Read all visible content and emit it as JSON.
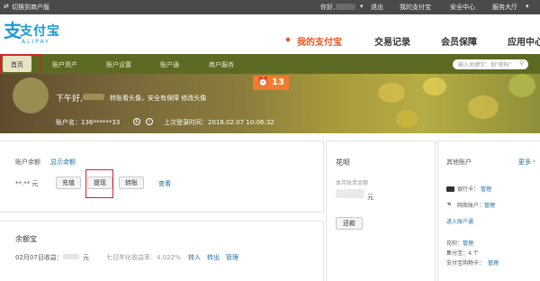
{
  "topbar": {
    "switch_label": "切换到商户版",
    "greeting": "你好,",
    "logout": "退出",
    "my_alipay": "我的支付宝",
    "security_center": "安全中心",
    "service_hall": "服务大厅"
  },
  "header": {
    "logo_cn": "支付宝",
    "logo_en": "ALIPAY",
    "nav": [
      "我的支付宝",
      "交易记录",
      "会员保障",
      "应用中心"
    ]
  },
  "subnav": {
    "items": [
      "首页",
      "账户资产",
      "账户设置",
      "账户通",
      "商户服务"
    ],
    "search_placeholder": "输入关键字：如\"密码\""
  },
  "banner": {
    "greeting": "下午好,",
    "tip": "转账看头像，安全有保障 修改头像",
    "badge_count": "13",
    "account_label": "账户名：136******33",
    "last_login": "上次登录时间：2018.02.07 10:06:32"
  },
  "balance": {
    "title": "账户余额",
    "show_link": "显示余额",
    "amount": "**.** 元",
    "recharge": "充值",
    "withdraw": "提现",
    "transfer": "转账",
    "view": "查看"
  },
  "yuebao": {
    "title": "余额宝",
    "income_label": "02月07日收益：",
    "income_unit": "元",
    "rate": "七日年化收益率：4.022%",
    "transfer_in": "转入",
    "transfer_out": "转出",
    "manage": "管理"
  },
  "huabei": {
    "title": "花呗",
    "bill_label": "本月账单金额",
    "unit": "元",
    "repay": "还款"
  },
  "other_accounts": {
    "title": "其他账户",
    "more": "更多",
    "bank_card": "银行卡：",
    "bank_manage": "管理",
    "netbank": "网商账户：",
    "netbank_manage": "管理",
    "enter_account": "进入账户通",
    "huabei": "花呗：",
    "huabei_manage": "管理",
    "alipay_card": "集分宝：4 个",
    "gift_card": "支付宝购物卡：",
    "gift_manage": "管理"
  }
}
